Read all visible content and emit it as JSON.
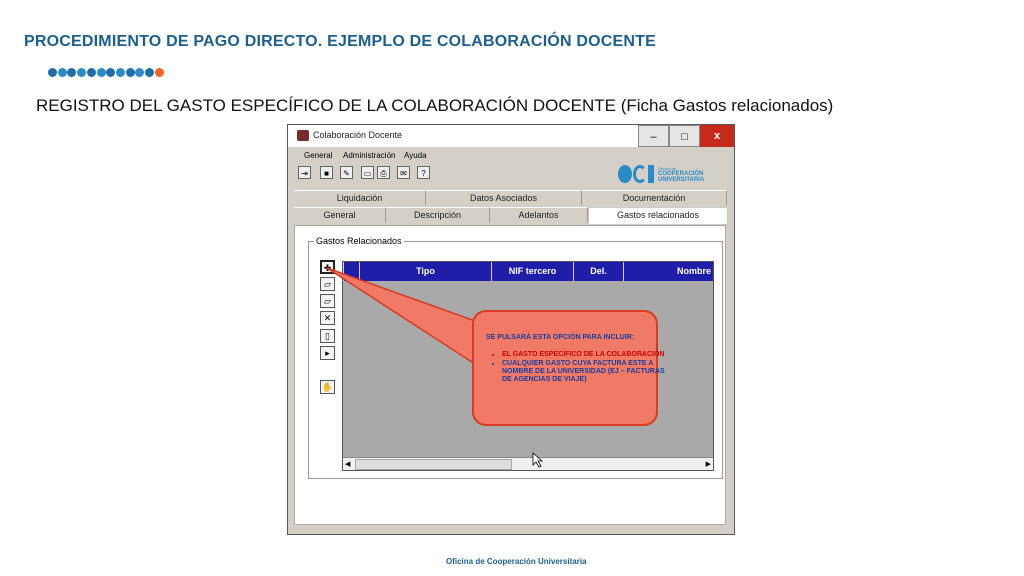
{
  "slide": {
    "title": "PROCEDIMIENTO DE PAGO DIRECTO. EJEMPLO DE COLABORACIÓN DOCENTE",
    "subtitle": "REGISTRO DEL GASTO ESPECÍFICO DE LA COLABORACIÓN DOCENTE (Ficha Gastos relacionados)",
    "footer": "Oficina de Cooperación Universitaria",
    "dot_colors": [
      "#1e6fa8",
      "#2a8bc9",
      "#1e6fa8",
      "#2a8bc9",
      "#1e6fa8",
      "#2a8bc9",
      "#1e6fa8",
      "#2a8bc9",
      "#1e6fa8",
      "#2a8bc9",
      "#1e6fa8",
      "#f26522"
    ]
  },
  "window": {
    "title": "Colaboración Docente",
    "minimize": "–",
    "maximize": "□",
    "close": "x",
    "menu": [
      "General",
      "Administración",
      "Ayuda"
    ],
    "toolbar_icons": [
      "exit-icon",
      "save-icon",
      "edit-icon",
      "preview-icon",
      "print-icon",
      "mail-icon",
      "help-icon"
    ],
    "logo": {
      "line1": "Oficina de",
      "line2": "COOPERACIÓN",
      "line3": "UNIVERSITARIA"
    },
    "tabs_back": [
      "Liquidación",
      "Datos Asociados",
      "Documentación"
    ],
    "tabs_front": [
      "General",
      "Descripción",
      "Adelantos",
      "Gastos relacionados"
    ],
    "active_tab": "Gastos relacionados"
  },
  "gastos": {
    "group_label": "Gastos Relacionados",
    "columns": [
      "Tipo",
      "NIF tercero",
      "Del.",
      "Nombre"
    ],
    "side_buttons": [
      "add-icon",
      "open-folder-icon",
      "open-folder-icon",
      "delete-icon",
      "new-document-icon",
      "new-document-arrow-icon",
      "hand-icon"
    ]
  },
  "callout": {
    "heading": "SE PULSARÁ ESTA OPCIÓN PARA INCLUIR:",
    "items": [
      {
        "text": "EL GASTO ESPECÍFICO DE LA COLABORACIÓN",
        "color": "#d00000"
      },
      {
        "text": "CUALQUIER GASTO CUYA FACTURA ESTE A NOMBRE DE LA UNIVERSIDAD (EJ – FACTURAS DE AGENCIAS DE VIAJE)",
        "color": "#1b3d9e"
      }
    ]
  }
}
